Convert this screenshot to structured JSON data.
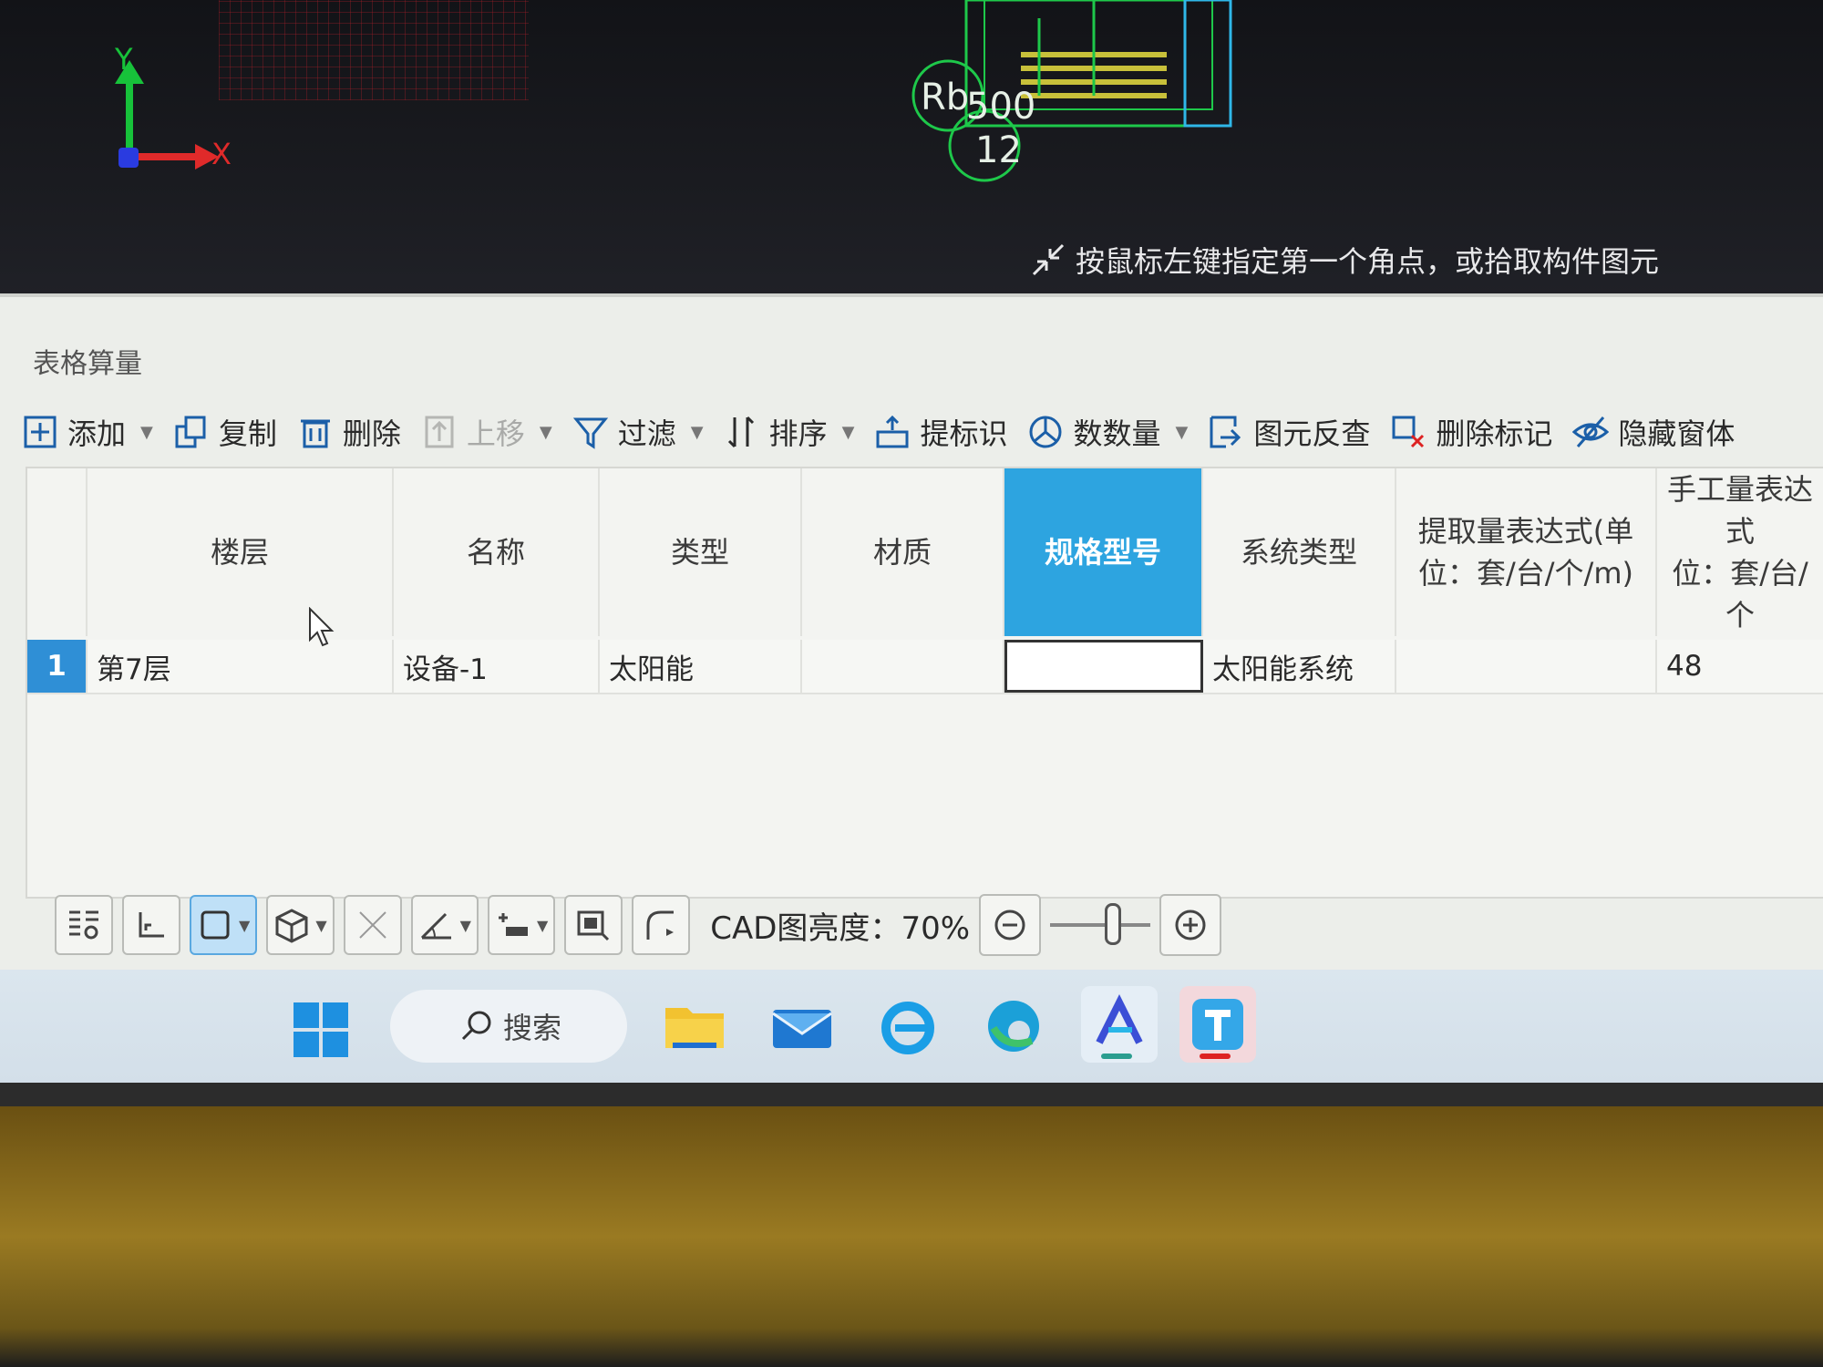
{
  "cad": {
    "axis_y_label": "Y",
    "axis_x_label": "X",
    "drawing_labels": [
      "Rb",
      "500",
      "12"
    ],
    "hint": "按鼠标左键指定第一个角点，或拾取构件图元"
  },
  "panel": {
    "title": "表格算量",
    "toolbar": [
      {
        "icon": "add-icon",
        "label": "添加",
        "dropdown": true,
        "disabled": false
      },
      {
        "icon": "copy-icon",
        "label": "复制",
        "dropdown": false,
        "disabled": false
      },
      {
        "icon": "delete-icon",
        "label": "删除",
        "dropdown": false,
        "disabled": false
      },
      {
        "icon": "move-up-icon",
        "label": "上移",
        "dropdown": true,
        "disabled": true
      },
      {
        "icon": "filter-icon",
        "label": "过滤",
        "dropdown": true,
        "disabled": false
      },
      {
        "icon": "sort-icon",
        "label": "排序",
        "dropdown": true,
        "disabled": false
      },
      {
        "icon": "mark-icon",
        "label": "提标识",
        "dropdown": false,
        "disabled": false
      },
      {
        "icon": "count-icon",
        "label": "数数量",
        "dropdown": true,
        "disabled": false
      },
      {
        "icon": "reverse-check-icon",
        "label": "图元反查",
        "dropdown": false,
        "disabled": false
      },
      {
        "icon": "delete-mark-icon",
        "label": "删除标记",
        "dropdown": false,
        "disabled": false
      },
      {
        "icon": "hide-icon",
        "label": "隐藏窗体",
        "dropdown": false,
        "disabled": false
      }
    ],
    "columns": [
      "",
      "楼层",
      "名称",
      "类型",
      "材质",
      "规格型号",
      "系统类型",
      "提取量表达式(单\n位：套/台/个/m)",
      "手工量表达式\n位：套/台/个"
    ],
    "selected_column": "规格型号",
    "rows": [
      {
        "num": "1",
        "cells": [
          "第7层",
          "设备-1",
          "太阳能",
          "",
          "",
          "太阳能系统",
          "",
          "48"
        ]
      }
    ]
  },
  "cad_toolbar": {
    "brightness_label": "CAD图亮度：",
    "brightness_value": "70%"
  },
  "taskbar": {
    "search_label": "搜索",
    "apps": [
      "file-explorer-icon",
      "mail-icon",
      "ie-icon",
      "edge-icon",
      "autodesk-icon",
      "tencent-app-icon"
    ]
  },
  "colors": {
    "accent": "#2da4e0",
    "row_number": "#2f8fd6",
    "axis_y": "#17c23a",
    "axis_x": "#e02a2a"
  }
}
